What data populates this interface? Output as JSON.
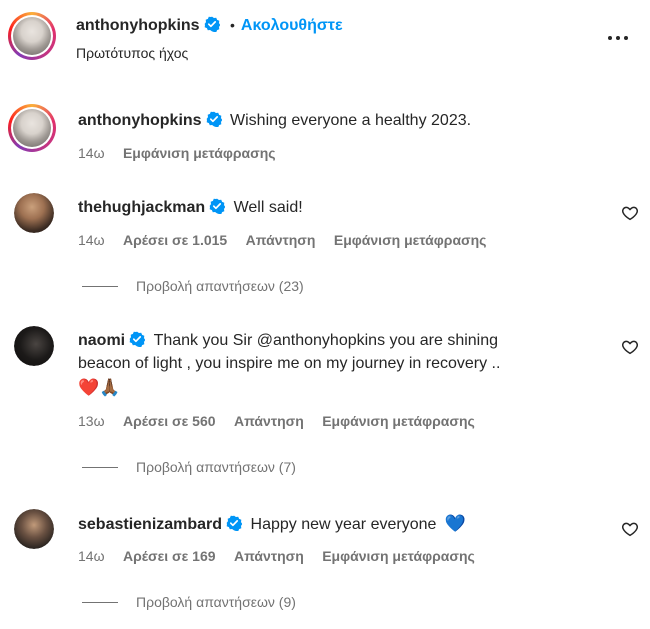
{
  "header": {
    "username": "anthonyhopkins",
    "separator": "•",
    "follow_label": "Ακολουθήστε",
    "subtitle": "Πρωτότυπος ήχος",
    "more_icon": "more-horizontal-icon"
  },
  "caption": {
    "username": "anthonyhopkins",
    "text": "Wishing everyone a healthy 2023.",
    "time": "14ω",
    "translate_label": "Εμφάνιση μετάφρασης"
  },
  "comments": [
    {
      "username": "thehughjackman",
      "text": "Well said!",
      "time": "14ω",
      "likes": "Αρέσει σε 1.015",
      "reply_label": "Απάντηση",
      "translate_label": "Εμφάνιση μετάφρασης",
      "view_replies": "Προβολή απαντήσεων (23)"
    },
    {
      "username": "naomi",
      "text_line1": "Thank you Sir @anthonyhopkins you are shining",
      "text_line2": "beacon of light , you inspire me on my journey in recovery ..",
      "emojis": "❤️🙏🏾",
      "time": "13ω",
      "likes": "Αρέσει σε 560",
      "reply_label": "Απάντηση",
      "translate_label": "Εμφάνιση μετάφρασης",
      "view_replies": "Προβολή απαντήσεων (7)"
    },
    {
      "username": "sebastienizambard",
      "text": "Happy new year everyone",
      "emoji": "💙",
      "time": "14ω",
      "likes": "Αρέσει σε 169",
      "reply_label": "Απάντηση",
      "translate_label": "Εμφάνιση μετάφρασης",
      "view_replies": "Προβολή απαντήσεων (9)"
    }
  ],
  "colors": {
    "verified": "#0095f6",
    "follow": "#0095f6",
    "secondary_text": "#737373",
    "heart_red": "#ed4956",
    "heart_blue": "#1f6fe0"
  }
}
